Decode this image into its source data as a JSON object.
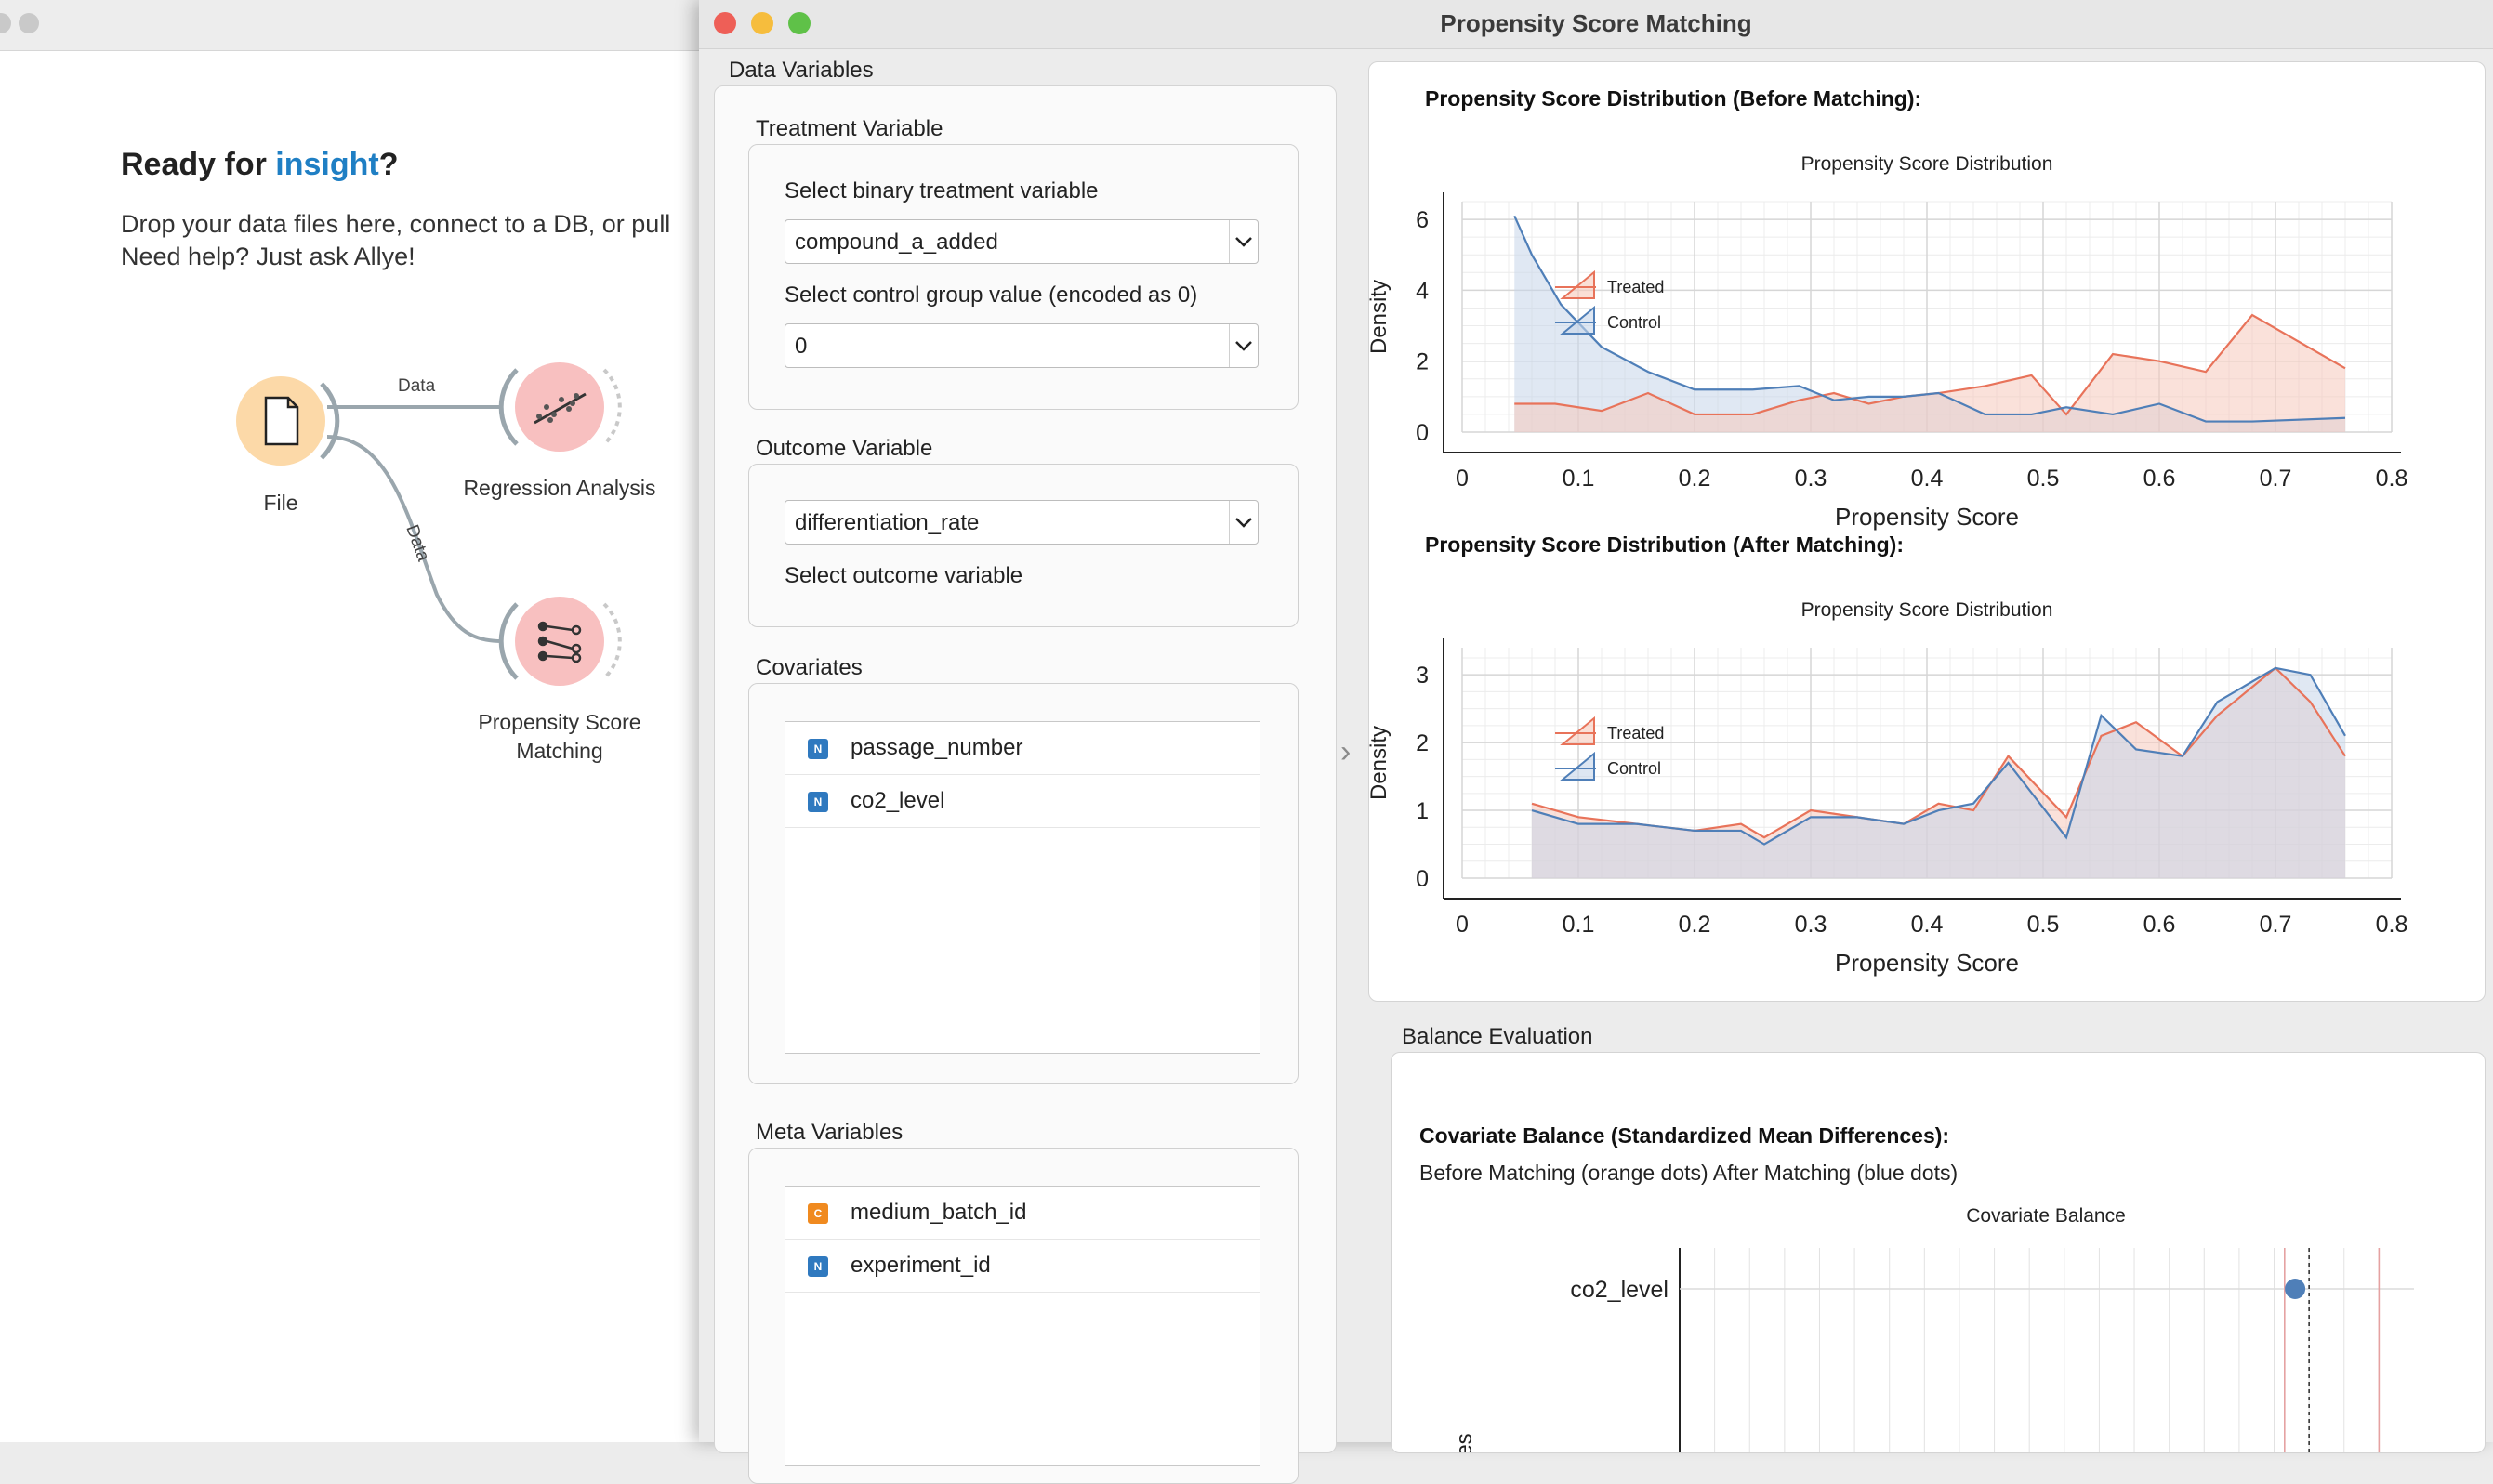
{
  "canvas": {
    "ready_prefix": "Ready for ",
    "ready_accent": "insight",
    "ready_suffix": "?",
    "desc_line1": "Drop your data files here, connect to a DB, or pull",
    "desc_line2": "Need help? Just ask Allye!",
    "widgets": {
      "file": "File",
      "regression": "Regression Analysis",
      "psm_line1": "Propensity Score",
      "psm_line2": "Matching"
    },
    "links": {
      "top": "Data",
      "bottom": "Data"
    }
  },
  "dialog": {
    "title": "Propensity Score Matching",
    "data_variables": "Data Variables",
    "treatment": {
      "title": "Treatment Variable",
      "select_label": "Select binary treatment variable",
      "selected": "compound_a_added",
      "control_label": "Select control group value (encoded as 0)",
      "control_value": "0"
    },
    "outcome": {
      "title": "Outcome Variable",
      "selected": "differentiation_rate",
      "hint": "Select outcome variable"
    },
    "covariates": {
      "title": "Covariates",
      "items": [
        {
          "badge": "N",
          "name": "passage_number"
        },
        {
          "badge": "N",
          "name": "co2_level"
        }
      ]
    },
    "meta": {
      "title": "Meta Variables",
      "items": [
        {
          "badge": "C",
          "name": "medium_batch_id"
        },
        {
          "badge": "N",
          "name": "experiment_id"
        }
      ]
    },
    "balance_title": "Balance Evaluation",
    "balance_heading": "Covariate Balance (Standardized Mean Differences):",
    "balance_sub": "Before Matching (orange dots) After Matching (blue dots)",
    "colors": {
      "treated": "#e8735a",
      "control": "#4f7fb8",
      "treated_fill": "#f6c9bb",
      "control_fill": "#c7d6ea"
    }
  },
  "chart_data": [
    {
      "type": "area",
      "heading": "Propensity Score Distribution (Before Matching):",
      "title": "Propensity Score Distribution",
      "xlabel": "Propensity Score",
      "ylabel": "Density",
      "xlim": [
        0,
        0.8
      ],
      "ylim": [
        0,
        6.5
      ],
      "xticks": [
        0,
        0.1,
        0.2,
        0.3,
        0.4,
        0.5,
        0.6,
        0.7,
        0.8
      ],
      "yticks": [
        0,
        2,
        4,
        6
      ],
      "legend": "left",
      "series": [
        {
          "name": "Treated",
          "x": [
            0.045,
            0.08,
            0.12,
            0.16,
            0.2,
            0.25,
            0.29,
            0.32,
            0.35,
            0.38,
            0.41,
            0.45,
            0.49,
            0.52,
            0.56,
            0.6,
            0.64,
            0.68,
            0.76
          ],
          "y": [
            0.8,
            0.8,
            0.6,
            1.1,
            0.5,
            0.5,
            0.9,
            1.1,
            0.8,
            1.0,
            1.1,
            1.3,
            1.6,
            0.5,
            2.2,
            2.0,
            1.7,
            3.3,
            1.8
          ]
        },
        {
          "name": "Control",
          "x": [
            0.045,
            0.06,
            0.085,
            0.12,
            0.16,
            0.2,
            0.25,
            0.29,
            0.32,
            0.35,
            0.38,
            0.41,
            0.45,
            0.49,
            0.52,
            0.56,
            0.6,
            0.64,
            0.68,
            0.76
          ],
          "y": [
            6.1,
            5.0,
            3.6,
            2.4,
            1.7,
            1.2,
            1.2,
            1.3,
            0.9,
            1.0,
            1.0,
            1.1,
            0.5,
            0.5,
            0.7,
            0.5,
            0.8,
            0.3,
            0.3,
            0.4
          ]
        }
      ]
    },
    {
      "type": "area",
      "heading": "Propensity Score Distribution (After Matching):",
      "title": "Propensity Score Distribution",
      "xlabel": "Propensity Score",
      "ylabel": "Density",
      "xlim": [
        0,
        0.8
      ],
      "ylim": [
        0,
        3.4
      ],
      "xticks": [
        0,
        0.1,
        0.2,
        0.3,
        0.4,
        0.5,
        0.6,
        0.7,
        0.8
      ],
      "yticks": [
        0,
        1,
        2,
        3
      ],
      "legend": "left",
      "series": [
        {
          "name": "Treated",
          "x": [
            0.06,
            0.1,
            0.15,
            0.2,
            0.24,
            0.26,
            0.3,
            0.34,
            0.38,
            0.41,
            0.44,
            0.47,
            0.52,
            0.55,
            0.58,
            0.62,
            0.65,
            0.7,
            0.73,
            0.76
          ],
          "y": [
            1.1,
            0.9,
            0.8,
            0.7,
            0.8,
            0.6,
            1.0,
            0.9,
            0.8,
            1.1,
            1.0,
            1.8,
            0.9,
            2.1,
            2.3,
            1.8,
            2.4,
            3.1,
            2.6,
            1.8
          ]
        },
        {
          "name": "Control",
          "x": [
            0.06,
            0.1,
            0.15,
            0.2,
            0.24,
            0.26,
            0.3,
            0.34,
            0.38,
            0.41,
            0.44,
            0.47,
            0.52,
            0.55,
            0.58,
            0.62,
            0.65,
            0.7,
            0.73,
            0.76
          ],
          "y": [
            1.0,
            0.8,
            0.8,
            0.7,
            0.7,
            0.5,
            0.9,
            0.9,
            0.8,
            1.0,
            1.1,
            1.7,
            0.6,
            2.4,
            1.9,
            1.8,
            2.6,
            3.1,
            3.0,
            2.1
          ]
        }
      ]
    },
    {
      "type": "scatter",
      "title": "Covariate Balance",
      "categories": [
        "co2_level"
      ],
      "ylabel_partial": "es",
      "series": [
        {
          "name": "After Matching",
          "color": "#4f7fb8",
          "x": [
            0.88
          ]
        }
      ],
      "ref_lines": [
        0.865,
        0.9,
        1.0
      ]
    }
  ]
}
